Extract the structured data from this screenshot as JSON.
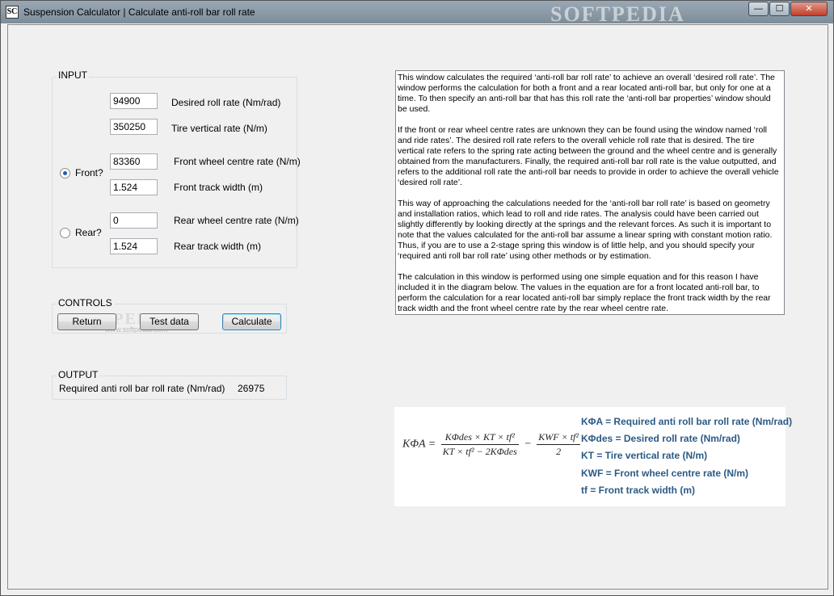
{
  "window": {
    "title": "Suspension Calculator | Calculate anti-roll bar roll rate",
    "icon_text": "SC",
    "watermark": "SOFTPEDIA",
    "controls": {
      "minimize": "—",
      "maximize": "☐",
      "close": "✕"
    }
  },
  "input": {
    "title": "INPUT",
    "desired_roll_rate": {
      "value": "94900",
      "label": "Desired roll rate (Nm/rad)"
    },
    "tire_vertical_rate": {
      "value": "350250",
      "label": "Tire vertical rate (N/m)"
    },
    "front": {
      "radio_label": "Front?",
      "checked": true,
      "wheel_centre_rate": {
        "value": "83360",
        "label": "Front wheel centre rate (N/m)"
      },
      "track_width": {
        "value": "1.524",
        "label": "Front track width (m)"
      }
    },
    "rear": {
      "radio_label": "Rear?",
      "checked": false,
      "wheel_centre_rate": {
        "value": "0",
        "label": "Rear wheel centre rate (N/m)"
      },
      "track_width": {
        "value": "1.524",
        "label": "Rear track width (m)"
      }
    }
  },
  "controls": {
    "title": "CONTROLS",
    "return_label": "Return",
    "test_data_label": "Test data",
    "calculate_label": "Calculate"
  },
  "output": {
    "title": "OUTPUT",
    "label": "Required anti roll bar roll rate (Nm/rad)",
    "value": "26975"
  },
  "watermark_mid": {
    "text": "SOFTPEDIA",
    "url": "www.softpedia.com"
  },
  "description": {
    "paragraphs": [
      "This window calculates the required ‘anti-roll bar roll rate’ to achieve an overall ‘desired roll rate’. The window performs the calculation for both a front and a rear located anti-roll bar, but only for one at a time. To then specify an anti-roll bar that has this roll rate the ‘anti-roll bar properties’ window should be used.",
      "If the front or rear wheel centre rates are unknown they can be found using the window named ‘roll and ride rates’. The desired roll rate refers to the overall vehicle roll rate that is desired.  The tire vertical rate refers to the spring rate acting between the ground and the wheel centre and is generally obtained from the manufacturers. Finally, the required anti-roll bar roll rate is the value outputted, and refers to the additional roll rate the anti-roll bar needs to provide in order to achieve the overall vehicle ‘desired roll rate’.",
      "This way of approaching the calculations needed for the ‘anti-roll bar roll rate’ is based on geometry and installation ratios, which lead to roll and ride rates. The analysis could have been carried out slightly differently by looking directly at the springs and the relevant forces. As such it is important to note that the values calculated for the anti-roll bar assume a linear spring with constant motion ratio. Thus, if you are to use a 2-stage spring this window is of little help, and you should specify your ‘required anti roll bar roll rate’ using other methods or by estimation.",
      "The calculation in this window is performed using one simple equation and for this reason I have included it in the diagram below.  The values in the equation are for a front located anti-roll bar, to perform the calculation for a rear located anti-roll bar simply replace the front track width by the rear track width and the front wheel centre rate by the rear wheel centre rate."
    ]
  },
  "formula": {
    "lhs": "KΦA =",
    "num1": "KΦdes × KT × tf²",
    "den1": "KT × tf² − 2KΦdes",
    "minus": "−",
    "num2": "KWF × tf²",
    "den2": "2",
    "legend": [
      "KΦA = Required anti roll bar roll rate (Nm/rad)",
      "KΦdes = Desired roll rate (Nm/rad)",
      "KT = Tire vertical rate (N/m)",
      "KWF = Front wheel centre rate (N/m)",
      "tf = Front track width (m)"
    ]
  }
}
